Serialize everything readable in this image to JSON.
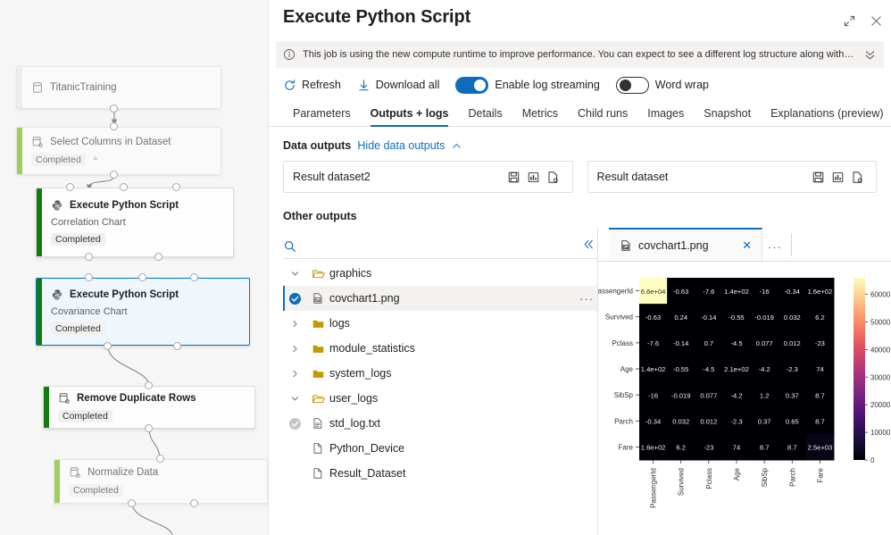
{
  "pipeline": {
    "nodes": [
      {
        "title": "TitanicTraining",
        "subtitle": "",
        "status": "",
        "icon": "dataset-icon",
        "state": "faded",
        "accent": "#ffffff"
      },
      {
        "title": "Select Columns in Dataset",
        "subtitle": "",
        "status": "Completed",
        "icon": "module-icon",
        "state": "faded",
        "accent": "#6bb700"
      },
      {
        "title": "Execute Python Script",
        "subtitle": "Correlation Chart",
        "status": "Completed",
        "icon": "python-icon",
        "state": "normal",
        "accent": "#107c10"
      },
      {
        "title": "Execute Python Script",
        "subtitle": "Covariance Chart",
        "status": "Completed",
        "icon": "python-icon",
        "state": "selected",
        "accent": "#107c10"
      },
      {
        "title": "Remove Duplicate Rows",
        "subtitle": "",
        "status": "Completed",
        "icon": "module-icon",
        "state": "normal",
        "accent": "#107c10"
      },
      {
        "title": "Normalize Data",
        "subtitle": "",
        "status": "Completed",
        "icon": "module-icon",
        "state": "faded",
        "accent": "#6bb700"
      }
    ]
  },
  "header": {
    "title": "Execute Python Script",
    "expand_icon": "expand-icon",
    "close_icon": "close-icon"
  },
  "infobar": {
    "icon": "info-icon",
    "message": "This job is using the new compute runtime to improve performance. You can expect to see a different log structure along with the new ...",
    "expand_icon": "chevron-double-down-icon"
  },
  "toolbar": {
    "refresh_label": "Refresh",
    "refresh_icon": "refresh-icon",
    "download_label": "Download all",
    "download_icon": "download-icon",
    "log_streaming_label": "Enable log streaming",
    "log_streaming_on": "on",
    "word_wrap_label": "Word wrap",
    "word_wrap_on": "off"
  },
  "tabs": {
    "items": [
      {
        "label": "Parameters",
        "active": "false"
      },
      {
        "label": "Outputs + logs",
        "active": "true"
      },
      {
        "label": "Details",
        "active": "false"
      },
      {
        "label": "Metrics",
        "active": "false"
      },
      {
        "label": "Child runs",
        "active": "false"
      },
      {
        "label": "Images",
        "active": "false"
      },
      {
        "label": "Snapshot",
        "active": "false"
      },
      {
        "label": "Explanations (preview)",
        "active": "false"
      }
    ],
    "overflow": "+"
  },
  "data_outputs": {
    "title": "Data outputs",
    "toggle_link": "Hide data outputs",
    "toggle_icon": "chevron-up-icon",
    "cards": [
      {
        "name": "Result dataset2",
        "icons": [
          "save-icon",
          "visualize-icon",
          "preview-icon"
        ]
      },
      {
        "name": "Result dataset",
        "icons": [
          "save-icon",
          "visualize-icon",
          "preview-icon"
        ]
      }
    ]
  },
  "other_outputs": {
    "title": "Other outputs",
    "search_placeholder": "",
    "search_value": "",
    "search_icon": "search-icon",
    "collapse_icon": "chevron-double-left-icon",
    "tree": [
      {
        "label": "graphics",
        "type": "folder-open",
        "indent": 0,
        "chevron": "down",
        "selected": "false",
        "check": "none"
      },
      {
        "label": "covchart1.png",
        "type": "image-file",
        "indent": 1,
        "chevron": "none",
        "selected": "true",
        "check": "checked"
      },
      {
        "label": "logs",
        "type": "folder",
        "indent": 0,
        "chevron": "right",
        "selected": "false",
        "check": "none"
      },
      {
        "label": "module_statistics",
        "type": "folder",
        "indent": 0,
        "chevron": "right",
        "selected": "false",
        "check": "none"
      },
      {
        "label": "system_logs",
        "type": "folder",
        "indent": 0,
        "chevron": "right",
        "selected": "false",
        "check": "none"
      },
      {
        "label": "user_logs",
        "type": "folder-open",
        "indent": 0,
        "chevron": "down",
        "selected": "false",
        "check": "none"
      },
      {
        "label": "std_log.txt",
        "type": "text-file",
        "indent": 1,
        "chevron": "none",
        "selected": "false",
        "check": "muted"
      },
      {
        "label": "Python_Device",
        "type": "blank-file",
        "indent": 0,
        "chevron": "none",
        "selected": "false",
        "check": "none"
      },
      {
        "label": "Result_Dataset",
        "type": "blank-file",
        "indent": 0,
        "chevron": "none",
        "selected": "false",
        "check": "none"
      }
    ]
  },
  "preview": {
    "tab_label": "covchart1.png",
    "tab_icon": "image-file-icon",
    "close_icon": "close-icon",
    "more_icon": "more-icon"
  },
  "colors": {
    "accent": "#0f6cbd",
    "link": "#0f6cbd",
    "success": "#107c10",
    "success_light": "#6bb700",
    "panel_bg": "#f3f2f1",
    "canvas_bg": "#f6f6f6",
    "selected_node_bg": "#eff6fc"
  },
  "chart_data": {
    "type": "heatmap",
    "title": "",
    "xlabel": "",
    "ylabel": "",
    "categories": [
      "PassengerId",
      "Survived",
      "Pclass",
      "Age",
      "SibSp",
      "Parch",
      "Fare"
    ],
    "x_tick_labels": [
      "PassengerId",
      "Survived",
      "Pclass",
      "Age",
      "SibSp",
      "Parch",
      "Fare"
    ],
    "y_tick_labels": [
      "PassengerId",
      "Survived",
      "Pclass",
      "Age",
      "SibSp",
      "Parch",
      "Fare"
    ],
    "annotations": [
      [
        "6.6e+04",
        "-0.63",
        "-7.6",
        "1.4e+02",
        "-16",
        "-0.34",
        "1.6e+02"
      ],
      [
        "-0.63",
        "0.24",
        "-0.14",
        "-0.55",
        "-0.019",
        "0.032",
        "6.2"
      ],
      [
        "-7.6",
        "-0.14",
        "0.7",
        "-4.5",
        "0.077",
        "0.012",
        "-23"
      ],
      [
        "1.4e+02",
        "-0.55",
        "-4.5",
        "2.1e+02",
        "-4.2",
        "-2.3",
        "74"
      ],
      [
        "-16",
        "-0.019",
        "0.077",
        "-4.2",
        "1.2",
        "0.37",
        "8.7"
      ],
      [
        "-0.34",
        "0.032",
        "0.012",
        "-2.3",
        "0.37",
        "0.65",
        "8.7"
      ],
      [
        "1.6e+02",
        "6.2",
        "-23",
        "74",
        "8.7",
        "8.7",
        "2.5e+03"
      ]
    ],
    "values": [
      [
        66000,
        -0.63,
        -7.6,
        140,
        -16,
        -0.34,
        160
      ],
      [
        -0.63,
        0.24,
        -0.14,
        -0.55,
        -0.019,
        0.032,
        6.2
      ],
      [
        -7.6,
        -0.14,
        0.7,
        -4.5,
        0.077,
        0.012,
        -23
      ],
      [
        140,
        -0.55,
        -4.5,
        210,
        -4.2,
        -2.3,
        74
      ],
      [
        -16,
        -0.019,
        0.077,
        -4.2,
        1.2,
        0.37,
        8.7
      ],
      [
        -0.34,
        0.032,
        0.012,
        -2.3,
        0.37,
        0.65,
        8.7
      ],
      [
        160,
        6.2,
        -23,
        74,
        8.7,
        8.7,
        2500
      ]
    ],
    "colorbar": {
      "ticks": [
        0,
        10000,
        20000,
        30000,
        40000,
        50000,
        60000
      ],
      "tick_labels": [
        "0",
        "10000",
        "20000",
        "30000",
        "40000",
        "50000",
        "60000"
      ],
      "vmin": 0,
      "vmax": 66000,
      "colormap": "magma"
    },
    "grid": "off",
    "legend_position": "right"
  }
}
